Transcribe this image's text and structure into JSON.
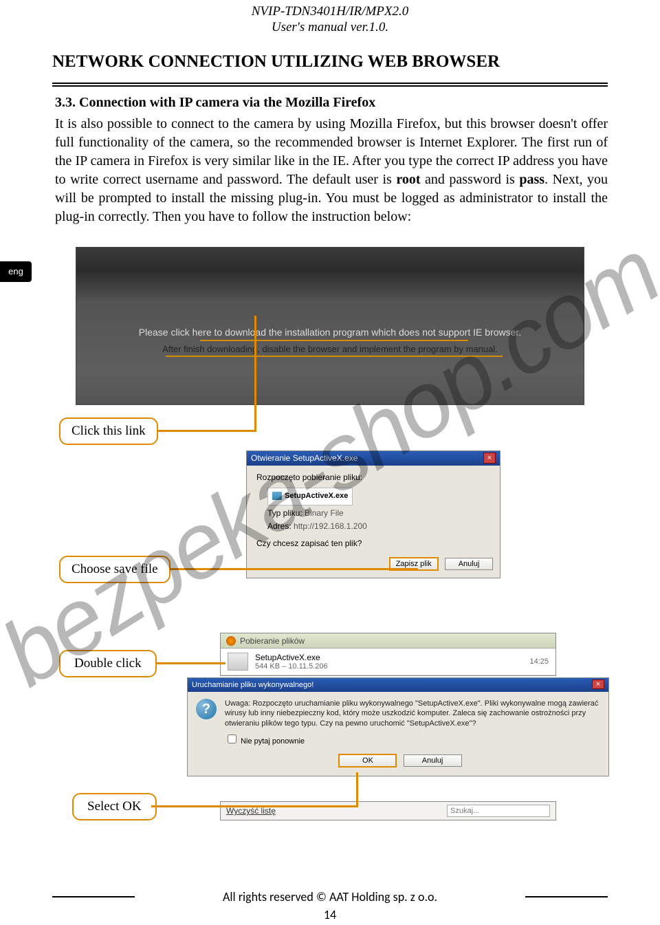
{
  "header": {
    "model": "NVIP-TDN3401H/IR/MPX2.0",
    "manual": "User's manual ver.1.0."
  },
  "section_title": "NETWORK CONNECTION UTILIZING WEB BROWSER",
  "subheading": "3.3. Connection with IP camera via the Mozilla Firefox",
  "paragraph_parts": {
    "p1": "It is also possible to connect to the camera by using Mozilla Firefox, but this browser doesn't offer full functionality of the camera, so the recommended browser is Internet Explorer. The first run of the IP camera in Firefox is very similar like in the IE. After you type the correct IP address you have to write correct username and password. The default user is ",
    "root": "root",
    "mid": " and password is ",
    "pass": "pass",
    "p2": ". Next, you will be prompted to install the missing plug-in. You must be logged as administrator to install the plug-in correctly. Then you have to follow the instruction below:"
  },
  "lang_tab": "eng",
  "browser_msg": {
    "line1": "Please click here to download the installation program which does not support IE browser.",
    "line2": "After finish downloading, disable the browser and implement the program by manual."
  },
  "callouts": {
    "click_link": "Click this link",
    "choose_save": "Choose save file",
    "double_click": "Double click",
    "select_ok": "Select OK"
  },
  "dialog_save": {
    "title": "Otwieranie SetupActiveX.exe",
    "line1": "Rozpoczęto pobieranie pliku:",
    "filename": "SetupActiveX.exe",
    "type_lbl": "Typ pliku:",
    "type_val": "Binary File",
    "addr_lbl": "Adres:",
    "addr_val": "http://192.168.1.200",
    "question": "Czy chcesz zapisać ten plik?",
    "btn_save": "Zapisz plik",
    "btn_cancel": "Anuluj"
  },
  "downloads": {
    "title": "Pobieranie plików",
    "file": "SetupActiveX.exe",
    "info": "544 KB – 10.11.5.206",
    "time": "14:25",
    "clear": "Wyczyść listę",
    "search_ph": "Szukaj..."
  },
  "sec_warn": {
    "title": "Uruchamianie pliku wykonywalnego!",
    "body": "Uwaga: Rozpoczęto uruchamianie pliku wykonywalnego \"SetupActiveX.exe\". Pliki wykonywalne mogą zawierać wirusy lub inny niebezpieczny kod, który może uszkodzić komputer. Zaleca się zachowanie ostrożności przy otwieraniu plików tego typu. Czy na pewno uruchomić \"SetupActiveX.exe\"?",
    "checkbox": "Nie pytaj ponownie",
    "ok": "OK",
    "cancel": "Anuluj"
  },
  "footer": "All rights reserved © AAT Holding sp. z o.o.",
  "page": "14",
  "watermark": "bezpeka-shop.com"
}
